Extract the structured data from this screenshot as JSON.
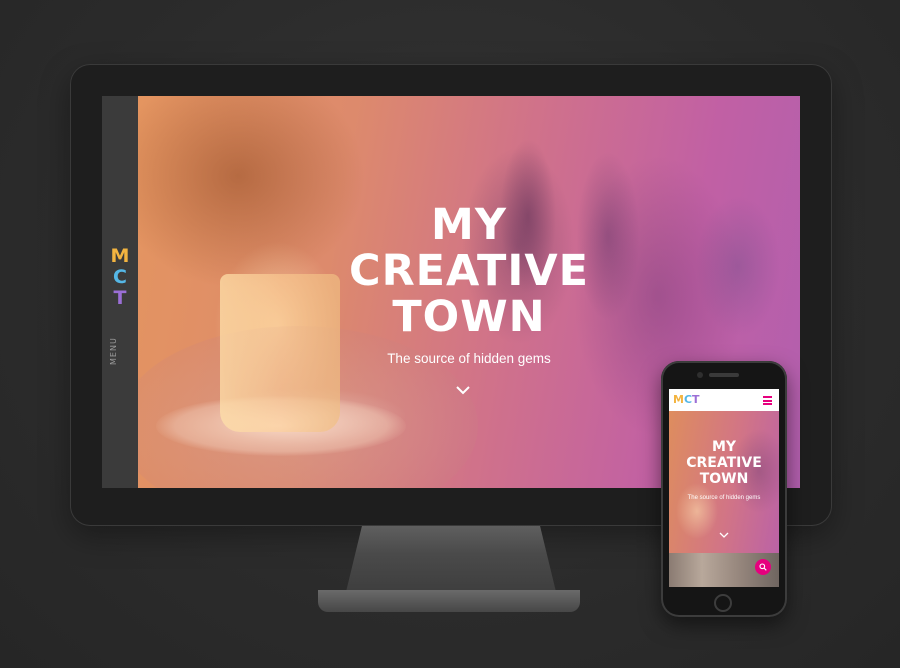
{
  "desktop": {
    "logo_letters": [
      "M",
      "C",
      "T"
    ],
    "logo_colors": [
      "#f3b440",
      "#55b7e6",
      "#9b6fd6"
    ],
    "menu_label": "MENU",
    "hero": {
      "title_lines": [
        "MY",
        "CREATIVE",
        "TOWN"
      ],
      "subtitle": "The source of hidden gems",
      "scroll_icon": "chevron-down-icon"
    }
  },
  "mobile": {
    "logo_text": "MCT",
    "menu_icon": "hamburger-icon",
    "accent": "#e6007e",
    "hero": {
      "title_lines": [
        "MY",
        "CREATIVE",
        "TOWN"
      ],
      "subtitle": "The source of hidden gems",
      "scroll_icon": "chevron-down-icon"
    },
    "search_icon": "search-icon"
  }
}
